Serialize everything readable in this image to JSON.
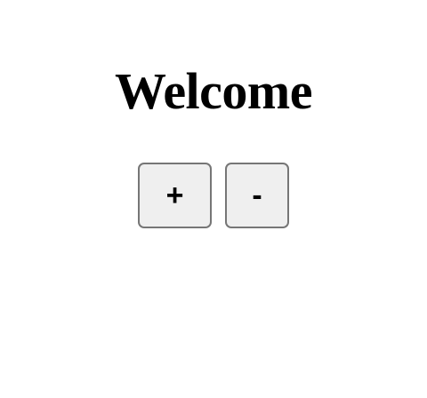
{
  "main": {
    "title": "Welcome",
    "buttons": {
      "increment_label": "+",
      "decrement_label": "-"
    }
  },
  "colors": {
    "background": "#ffffff",
    "button_background": "#efefef",
    "button_border": "#767676",
    "text": "#000000"
  }
}
